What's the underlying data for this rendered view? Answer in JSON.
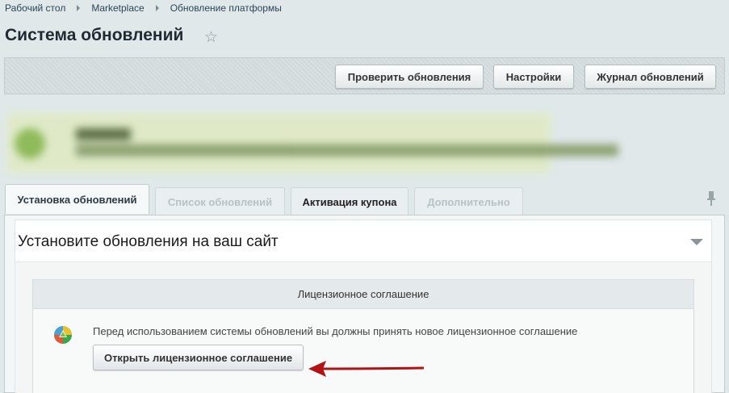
{
  "breadcrumb": {
    "items": [
      "Рабочий стол",
      "Marketplace",
      "Обновление платформы"
    ]
  },
  "page": {
    "title": "Система обновлений"
  },
  "toolbar": {
    "check_updates": "Проверить обновления",
    "settings": "Настройки",
    "updates_log": "Журнал обновлений"
  },
  "tabs": [
    {
      "label": "Установка обновлений",
      "state": "active"
    },
    {
      "label": "Список обновлений",
      "state": "disabled"
    },
    {
      "label": "Активация купона",
      "state": "normal"
    },
    {
      "label": "Дополнительно",
      "state": "disabled"
    }
  ],
  "section": {
    "title": "Установите обновления на ваш сайт"
  },
  "license": {
    "header": "Лицензионное соглашение",
    "text": "Перед использованием системы обновлений вы должны принять новое лицензионное соглашение",
    "button": "Открыть лицензионное соглашение"
  },
  "colors": {
    "background": "#e0e8ea",
    "notice_green": "#dfe9c7",
    "arrow_red": "#b31212"
  }
}
